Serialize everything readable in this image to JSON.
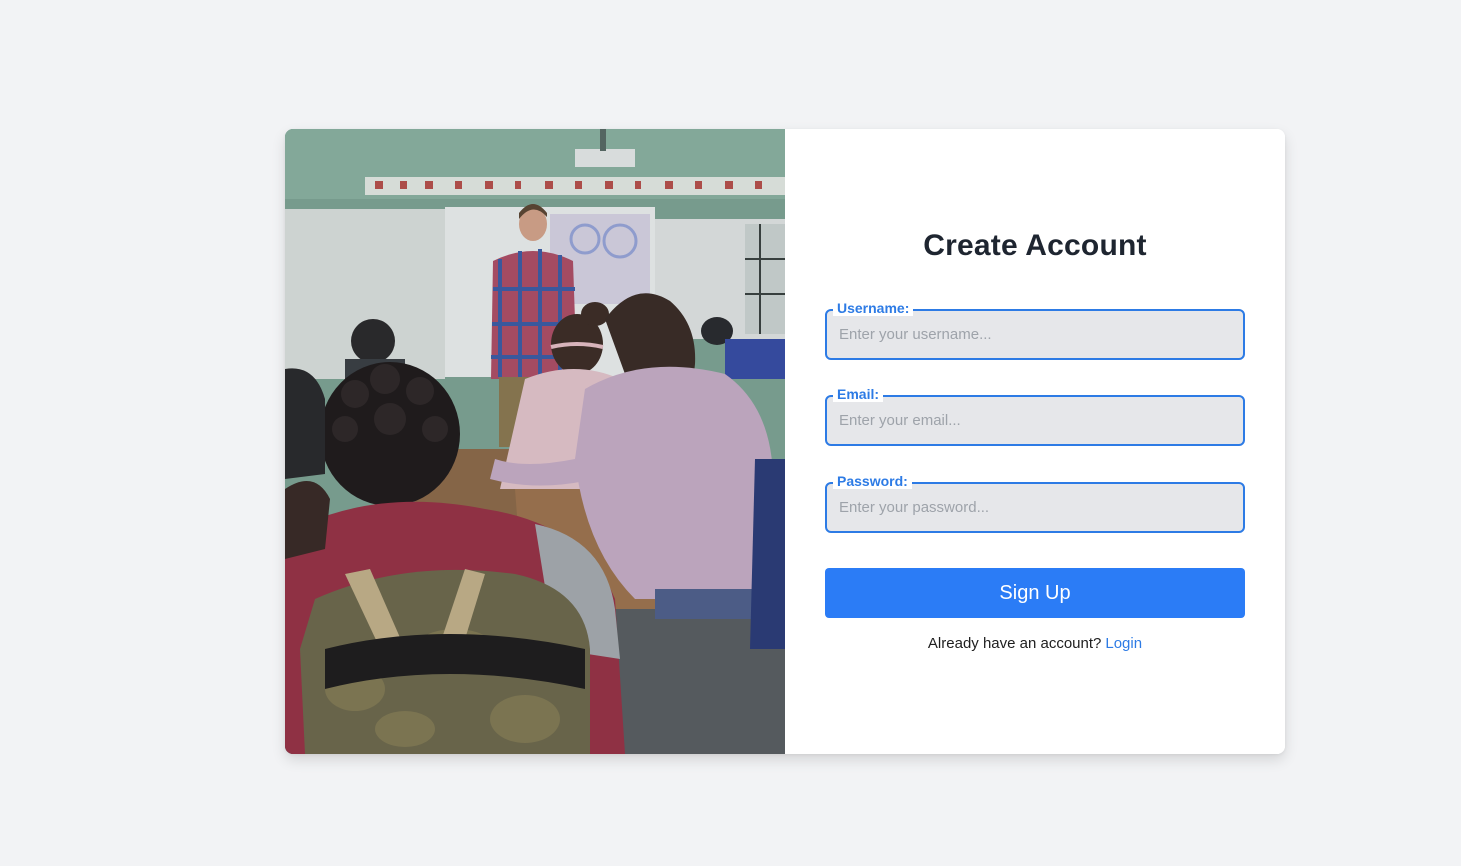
{
  "signup_form": {
    "title": "Create Account",
    "fields": {
      "username": {
        "label": "Username:",
        "placeholder": "Enter your username...",
        "value": ""
      },
      "email": {
        "label": "Email:",
        "placeholder": "Enter your email...",
        "value": ""
      },
      "password": {
        "label": "Password:",
        "placeholder": "Enter your password...",
        "value": ""
      }
    },
    "submit_label": "Sign Up",
    "login_prompt": "Already have an account?",
    "login_link": "Login"
  },
  "colors": {
    "accent": "#2d7be5",
    "button": "#2b7cf6",
    "page_background": "#f2f3f5",
    "input_background": "#e6e7ea"
  }
}
